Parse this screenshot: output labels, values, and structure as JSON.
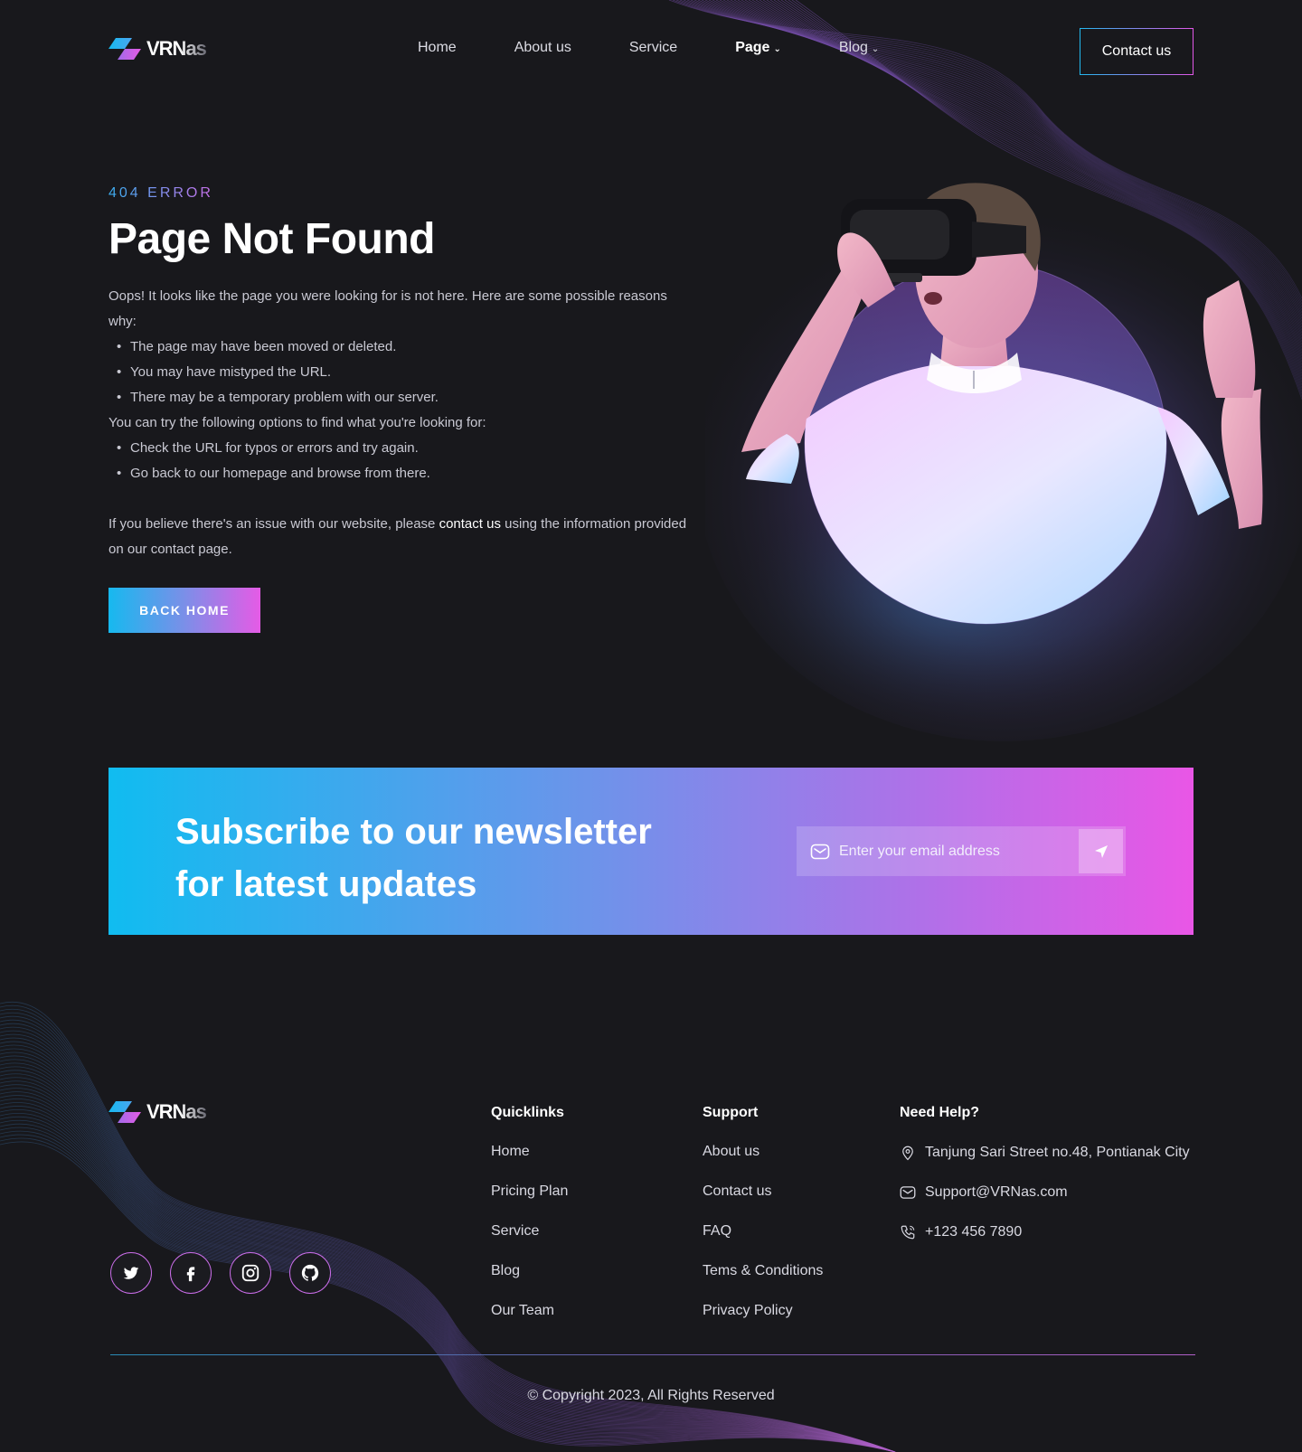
{
  "brand": {
    "name": "VRNas",
    "colors": {
      "cyan": "#16b9ef",
      "magenta": "#e55be6",
      "background": "#18181c"
    }
  },
  "nav": {
    "items": [
      {
        "label": "Home",
        "dropdown": false,
        "active": false
      },
      {
        "label": "About us",
        "dropdown": false,
        "active": false
      },
      {
        "label": "Service",
        "dropdown": false,
        "active": false
      },
      {
        "label": "Page",
        "dropdown": true,
        "active": true
      },
      {
        "label": "Blog",
        "dropdown": true,
        "active": false
      }
    ],
    "cta": "Contact us"
  },
  "hero": {
    "eyebrow": "404 ERROR",
    "title": "Page Not Found",
    "intro": "Oops! It looks like the page you were looking for is not here. Here are some possible reasons why:",
    "reasons": [
      "The page may have been moved or deleted.",
      "You may have mistyped the URL.",
      "There may be a temporary problem with our server."
    ],
    "options_intro": "You can try the following options to find what you're looking for:",
    "options": [
      "Check the URL for typos or errors and try again.",
      "Go back to our homepage and browse from there."
    ],
    "note_before": "If you believe there's an issue with our website, please ",
    "note_link": "contact us",
    "note_after": " using the information provided on our contact page.",
    "button": "BACK HOME"
  },
  "newsletter": {
    "heading_line1": "Subscribe to our newsletter",
    "heading_line2": "for latest updates",
    "placeholder": "Enter your email address",
    "icon": "mail-icon",
    "send_icon": "send-icon"
  },
  "footer": {
    "socials": [
      "twitter-icon",
      "facebook-icon",
      "instagram-icon",
      "github-icon"
    ],
    "quicklinks": {
      "title": "Quicklinks",
      "links": [
        "Home",
        "Pricing Plan",
        "Service",
        "Blog",
        "Our Team"
      ]
    },
    "support": {
      "title": "Support",
      "links": [
        "About us",
        "Contact us",
        "FAQ",
        "Tems & Conditions",
        "Privacy Policy"
      ]
    },
    "help": {
      "title": "Need Help?",
      "address": "Tanjung Sari Street no.48, Pontianak City",
      "email": "Support@VRNas.com",
      "phone": "+123 456 7890"
    },
    "copyright": "© Copyright 2023, All Rights Reserved"
  }
}
